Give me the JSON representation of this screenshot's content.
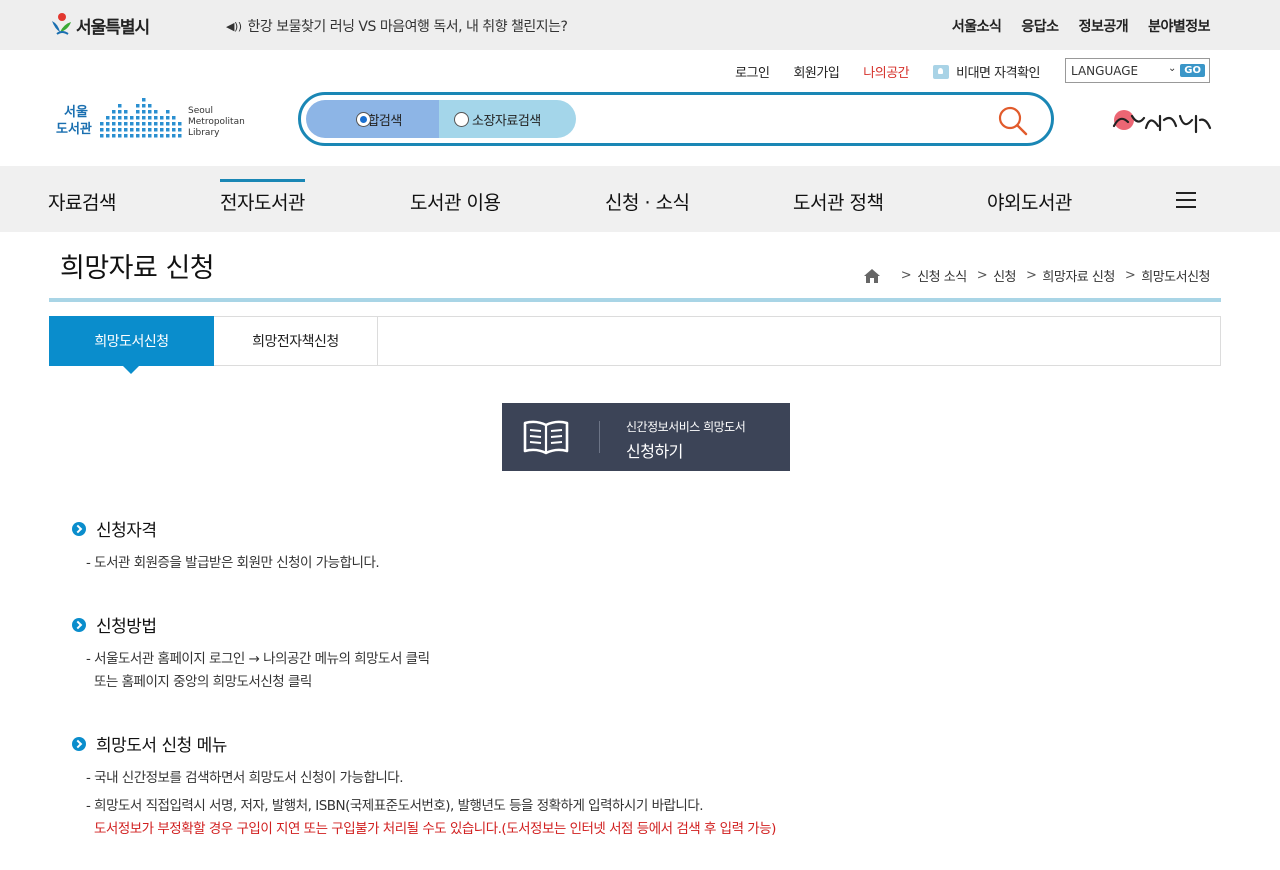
{
  "topbar": {
    "seoul_logo_text": "서울특별시",
    "notice": "한강 보물찾기 러닝 VS 마음여행 독서, 내 취향 챌린지는?",
    "links": [
      "서울소식",
      "응답소",
      "정보공개",
      "분야별정보"
    ]
  },
  "util": {
    "login": "로그인",
    "join": "회원가입",
    "myspace": "나의공간",
    "verify": "비대면 자격확인",
    "language": "LANGUAGE",
    "go": "GO"
  },
  "logo": {
    "kr_line1": "서울",
    "kr_line2": "도서관",
    "en_line1": "Seoul",
    "en_line2": "Metropolitan",
    "en_line3": "Library"
  },
  "search": {
    "tab_integrated": "통합검색",
    "tab_holdings": "소장자료검색",
    "value": "",
    "placeholder": ""
  },
  "gnb": {
    "items": [
      "자료검색",
      "전자도서관",
      "도서관 이용",
      "신청 · 소식",
      "도서관 정책",
      "야외도서관"
    ]
  },
  "page": {
    "title": "희망자료 신청",
    "breadcrumb": [
      "신청 소식",
      "신청",
      "희망자료 신청",
      "희망도서신청"
    ]
  },
  "subtabs": [
    "희망도서신청",
    "희망전자책신청"
  ],
  "banner": {
    "line1": "신간정보서비스 희망도서",
    "line2": "신청하기"
  },
  "sections": {
    "s1_title": "신청자격",
    "s1_l1": "- 도서관 회원증을 발급받은 회원만 신청이 가능합니다.",
    "s2_title": "신청방법",
    "s2_l1": "- 서울도서관 홈페이지 로그인 → 나의공간 메뉴의 희망도서 클릭",
    "s2_l2": "또는 홈페이지 중앙의 희망도서신청 클릭",
    "s3_title": "희망도서 신청 메뉴",
    "s3_l1": "- 국내 신간정보를 검색하면서 희망도서 신청이 가능합니다.",
    "s3_l2": "- 희망도서 직접입력시 서명, 저자, 발행처, ISBN(국제표준도서번호), 발행년도 등을 정확하게 입력하시기 바랍니다.",
    "s3_l3": "도서정보가 부정확할 경우 구입이 지연 또는 구입불가 처리될 수도 있습니다.(도서정보는 인터넷 서점 등에서 검색 후 입력 가능)"
  },
  "colors": {
    "accent": "#0a8dcc",
    "search_border": "#1a87b5",
    "warning": "#d12020",
    "banner_bg": "#3c4457"
  }
}
